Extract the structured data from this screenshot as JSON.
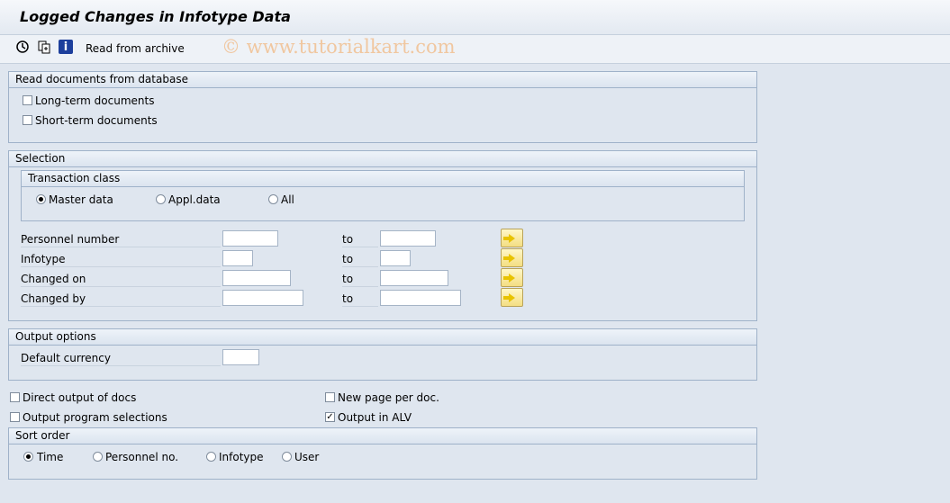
{
  "title": "Logged Changes in Infotype Data",
  "toolbar": {
    "execute_icon": "execute-clock-icon",
    "variant_icon": "get-variant-icon",
    "info_icon": "information-icon",
    "read_archive_label": "Read from archive"
  },
  "watermark": "© www.tutorialkart.com",
  "read_docs": {
    "heading": "Read documents from database",
    "long_term": "Long-term documents",
    "short_term": "Short-term documents"
  },
  "selection": {
    "heading": "Selection",
    "transaction_class": {
      "heading": "Transaction class",
      "options": [
        "Master data",
        "Appl.data",
        "All"
      ],
      "selected": "Master data"
    },
    "rows": [
      {
        "label": "Personnel number",
        "from": "",
        "to_label": "to",
        "to": ""
      },
      {
        "label": "Infotype",
        "from": "",
        "to_label": "to",
        "to": ""
      },
      {
        "label": "Changed on",
        "from": "",
        "to_label": "to",
        "to": ""
      },
      {
        "label": "Changed by",
        "from": "",
        "to_label": "to",
        "to": ""
      }
    ]
  },
  "output_options": {
    "heading": "Output options",
    "default_currency_label": "Default currency",
    "default_currency": ""
  },
  "checks": {
    "direct_output": "Direct output of docs",
    "new_page": "New page per doc.",
    "output_selections": "Output program selections",
    "output_alv": "Output in ALV",
    "output_alv_checked": true
  },
  "sort_order": {
    "heading": "Sort order",
    "options": [
      "Time",
      "Personnel no.",
      "Infotype",
      "User"
    ],
    "selected": "Time"
  },
  "colors": {
    "background": "#dfe6ef",
    "group_border": "#9fb2c9",
    "multi_button": "#f4de82"
  }
}
